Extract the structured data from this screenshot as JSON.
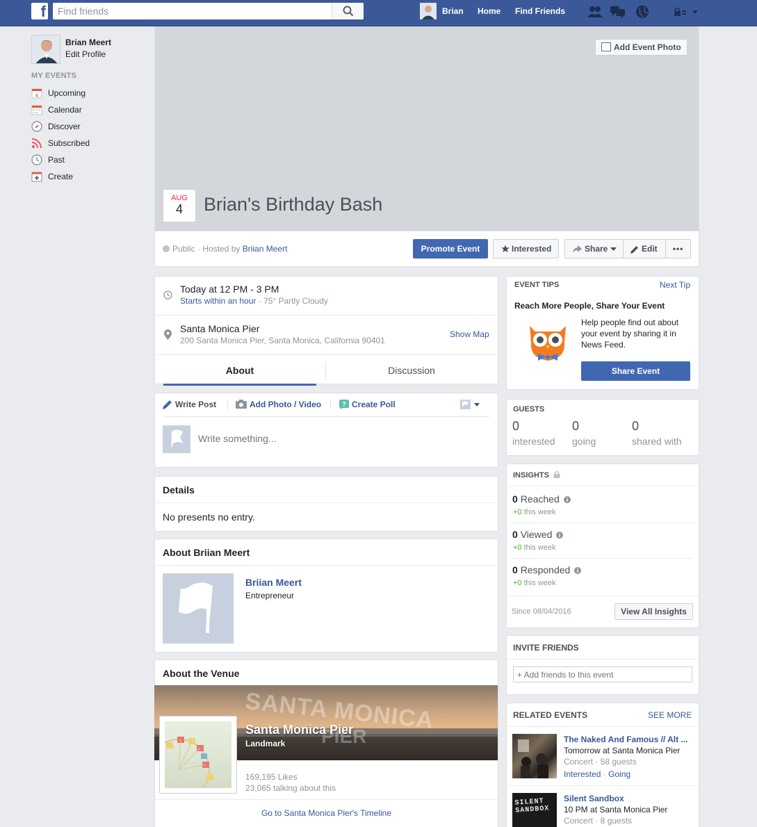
{
  "topbar": {
    "search_placeholder": "Find friends",
    "user_name": "Brian",
    "home": "Home",
    "find_friends": "Find Friends"
  },
  "left_nav": {
    "profile_name": "Brian Meert",
    "edit_profile": "Edit Profile",
    "section_title": "MY EVENTS",
    "calendar_icon_day": "4",
    "items": [
      {
        "label": "Upcoming",
        "icon": "calendar-day-icon"
      },
      {
        "label": "Calendar",
        "icon": "calendar-icon"
      },
      {
        "label": "Discover",
        "icon": "compass-icon"
      },
      {
        "label": "Subscribed",
        "icon": "rss-icon"
      },
      {
        "label": "Past",
        "icon": "clock-icon"
      },
      {
        "label": "Create",
        "icon": "plus-icon"
      }
    ]
  },
  "cover": {
    "add_photo": "Add Event Photo",
    "month": "AUG",
    "day": "4",
    "title": "Brian's Birthday Bash"
  },
  "action_bar": {
    "privacy": "Public · Hosted by ",
    "host": "Briian Meert",
    "promote": "Promote Event",
    "interested": "Interested",
    "share": "Share",
    "edit": "Edit",
    "more": "•••"
  },
  "event_info": {
    "time": "Today at 12 PM - 3 PM",
    "starts": "Starts within an hour",
    "weather": " · 75° Partly Cloudy",
    "place": "Santa Monica Pier",
    "address": "200 Santa Monica Pier, Santa Monica, California 90401",
    "show_map": "Show Map",
    "tab_about": "About",
    "tab_discussion": "Discussion"
  },
  "composer": {
    "write_post": "Write Post",
    "add_photo": "Add Photo / Video",
    "create_poll": "Create Poll",
    "placeholder": "Write something..."
  },
  "details": {
    "title": "Details",
    "text": "No presents no entry."
  },
  "about_host": {
    "title": "About Briian Meert",
    "name": "Briian Meert",
    "role": "Entrepreneur"
  },
  "venue": {
    "title": "About the Venue",
    "name": "Santa Monica Pier",
    "type": "Landmark",
    "likes": "169,195 Likes",
    "talking": "23,065 talking about this",
    "timeline_link": "Go to Santa Monica Pier's Timeline",
    "sign_line1": "SANTA MONICA",
    "sign_line2": "PIER"
  },
  "tips": {
    "title": "EVENT TIPS",
    "next": "Next Tip",
    "heading": "Reach More People, Share Your Event",
    "body": "Help people find out about your event by sharing it in News Feed.",
    "button": "Share Event"
  },
  "guests": {
    "title": "GUESTS",
    "stats": [
      {
        "value": "0",
        "label": "interested"
      },
      {
        "value": "0",
        "label": "going"
      },
      {
        "value": "0",
        "label": "shared with"
      }
    ]
  },
  "insights": {
    "title": "INSIGHTS",
    "rows": [
      {
        "value": "0",
        "label": "Reached",
        "delta": "+0",
        "period": " this week"
      },
      {
        "value": "0",
        "label": "Viewed",
        "delta": "+0",
        "period": " this week"
      },
      {
        "value": "0",
        "label": "Responded",
        "delta": "+0",
        "period": " this week"
      }
    ],
    "since": "Since 08/04/2016",
    "button": "View All Insights"
  },
  "invite": {
    "title": "INVITE FRIENDS",
    "placeholder": "+ Add friends to this event"
  },
  "related": {
    "title": "RELATED EVENTS",
    "see_more": "SEE MORE",
    "events": [
      {
        "title": "The Naked And Famous // Alt ...",
        "when": "Tomorrow at Santa Monica Pier",
        "meta": "Concert · 58 guests",
        "interested": "Interested",
        "going": "Going"
      },
      {
        "title": "Silent Sandbox",
        "when": "10 PM at Santa Monica Pier",
        "meta": "Concert · 8 guests",
        "thumb_line1": "SILENT",
        "thumb_line2": "SANDBOX"
      }
    ]
  },
  "colors": {
    "brand": "#3b5998",
    "button_blue": "#4267b2",
    "link": "#365899",
    "green": "#42b72a"
  }
}
